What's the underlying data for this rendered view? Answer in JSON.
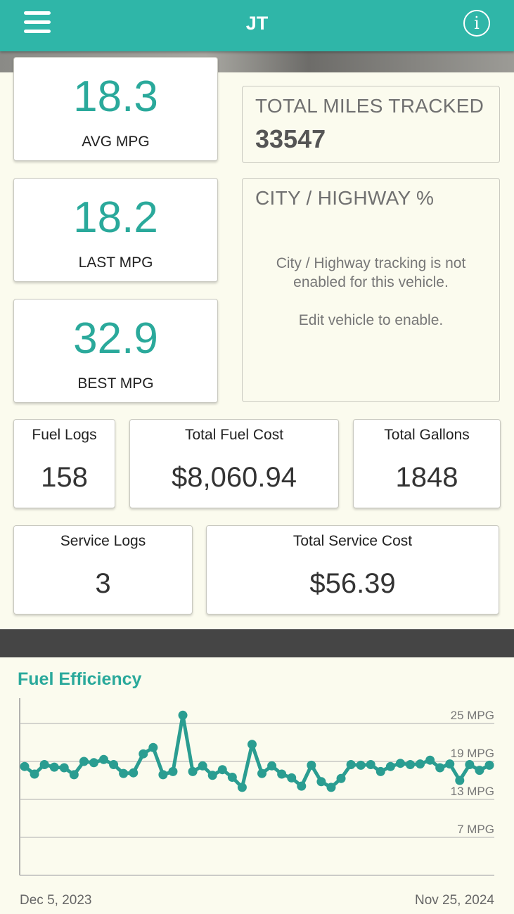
{
  "header": {
    "title": "JT",
    "menu_icon": "menu-icon",
    "info_icon": "info-icon",
    "info_glyph": "i"
  },
  "mpg": {
    "avg": {
      "value": "18.3",
      "label": "AVG MPG"
    },
    "last": {
      "value": "18.2",
      "label": "LAST MPG"
    },
    "best": {
      "value": "32.9",
      "label": "BEST MPG"
    }
  },
  "miles": {
    "title": "TOTAL MILES TRACKED",
    "value": "33547"
  },
  "city_highway": {
    "title": "CITY / HIGHWAY %",
    "message_line1": "City / Highway tracking is not",
    "message_line2": "enabled for this vehicle.",
    "message_line3": "Edit vehicle to enable."
  },
  "fuel_stats": {
    "logs": {
      "label": "Fuel Logs",
      "value": "158"
    },
    "cost": {
      "label": "Total Fuel Cost",
      "value": "$8,060.94"
    },
    "gallons": {
      "label": "Total Gallons",
      "value": "1848"
    }
  },
  "service_stats": {
    "logs": {
      "label": "Service Logs",
      "value": "3"
    },
    "cost": {
      "label": "Total Service Cost",
      "value": "$56.39"
    }
  },
  "colors": {
    "accent": "#2fb6a8",
    "line": "#2a9d91",
    "background": "#fbfbee"
  },
  "chart_data": {
    "type": "line",
    "title": "Fuel Efficiency",
    "x_start_label": "Dec 5, 2023",
    "x_end_label": "Nov 25, 2024",
    "y_ticks": [
      {
        "value": 25,
        "label": "25 MPG"
      },
      {
        "value": 19,
        "label": "19 MPG"
      },
      {
        "value": 13,
        "label": "13 MPG"
      },
      {
        "value": 7,
        "label": "7 MPG"
      }
    ],
    "ylim": [
      0,
      27
    ],
    "grid": true,
    "series": [
      {
        "values": [
          18.2,
          17.0,
          18.5,
          18.1,
          18.0,
          16.9,
          19.0,
          18.8,
          19.3,
          18.5,
          17.1,
          17.2,
          20.2,
          21.2,
          16.9,
          17.4,
          26.3,
          17.4,
          18.3,
          16.8,
          17.7,
          16.5,
          14.9,
          21.7,
          17.1,
          18.3,
          17.0,
          16.4,
          15.1,
          18.4,
          15.8,
          14.9,
          16.3,
          18.5,
          18.4,
          18.5,
          17.4,
          18.2,
          18.7,
          18.5,
          18.6,
          19.2,
          18.0,
          18.6,
          16.0,
          18.5,
          17.6,
          18.4
        ]
      }
    ]
  }
}
